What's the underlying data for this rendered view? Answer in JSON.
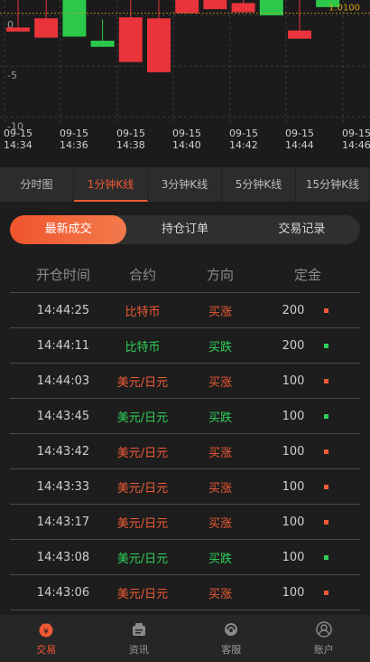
{
  "chart_data": {
    "type": "candlestick",
    "y_ticks": [
      "0",
      "-5",
      "-10"
    ],
    "x_labels": [
      {
        "date": "09-15",
        "time": "14:34"
      },
      {
        "date": "09-15",
        "time": "14:36"
      },
      {
        "date": "09-15",
        "time": "14:38"
      },
      {
        "date": "09-15",
        "time": "14:40"
      },
      {
        "date": "09-15",
        "time": "14:42"
      },
      {
        "date": "09-15",
        "time": "14:44"
      },
      {
        "date": "09-15",
        "time": "14:46"
      }
    ],
    "current_price_label": "1.0100",
    "ylim": [
      -10.5,
      1.5
    ],
    "candles": [
      {
        "open": -1.2,
        "close": -1.6,
        "high": 1.5,
        "low": -1.6
      },
      {
        "open": -0.3,
        "close": -2.2,
        "high": 1.5,
        "low": -2.2
      },
      {
        "open": -2.1,
        "close": 1.5,
        "high": 1.5,
        "low": -2.1
      },
      {
        "open": -3.1,
        "close": -2.5,
        "high": -0.4,
        "low": -3.1
      },
      {
        "open": -0.2,
        "close": -4.6,
        "high": 1.5,
        "low": -4.6
      },
      {
        "open": -0.3,
        "close": -5.6,
        "high": 1.5,
        "low": -5.6
      },
      {
        "open": 1.5,
        "close": 0.2,
        "high": 1.5,
        "low": 0.2
      },
      {
        "open": 1.5,
        "close": 0.6,
        "high": 1.5,
        "low": 0.6
      },
      {
        "open": 1.2,
        "close": 0.3,
        "high": 1.5,
        "low": 0.3
      },
      {
        "open": 0.0,
        "close": 1.5,
        "high": 1.5,
        "low": 0.0
      },
      {
        "open": -1.5,
        "close": -2.3,
        "high": 1.5,
        "low": -2.3
      },
      {
        "open": 0.8,
        "close": 1.5,
        "high": 1.5,
        "low": 0.8
      }
    ],
    "colors": {
      "up": "#e8343a",
      "down": "#2cc84a",
      "grid": "#3a3a3a",
      "price": "#d4a017"
    }
  },
  "period_tabs": [
    "分时图",
    "1分钟K线",
    "3分钟K线",
    "5分钟K线",
    "15分钟K线"
  ],
  "active_period": 1,
  "segments": [
    "最新成交",
    "持仓订单",
    "交易记录"
  ],
  "active_segment": 0,
  "table": {
    "headers": {
      "time": "开仓时间",
      "contract": "合约",
      "direction": "方向",
      "amount": "定金"
    },
    "rows": [
      {
        "time": "14:44:25",
        "contract": "比特币",
        "direction": "买涨",
        "amount": "200",
        "side": "up"
      },
      {
        "time": "14:44:11",
        "contract": "比特币",
        "direction": "买跌",
        "amount": "200",
        "side": "down"
      },
      {
        "time": "14:44:03",
        "contract": "美元/日元",
        "direction": "买涨",
        "amount": "100",
        "side": "up"
      },
      {
        "time": "14:43:45",
        "contract": "美元/日元",
        "direction": "买跌",
        "amount": "100",
        "side": "down"
      },
      {
        "time": "14:43:42",
        "contract": "美元/日元",
        "direction": "买涨",
        "amount": "100",
        "side": "up"
      },
      {
        "time": "14:43:33",
        "contract": "美元/日元",
        "direction": "买涨",
        "amount": "100",
        "side": "up"
      },
      {
        "time": "14:43:17",
        "contract": "美元/日元",
        "direction": "买涨",
        "amount": "100",
        "side": "up"
      },
      {
        "time": "14:43:08",
        "contract": "美元/日元",
        "direction": "买跌",
        "amount": "100",
        "side": "down"
      },
      {
        "time": "14:43:06",
        "contract": "美元/日元",
        "direction": "买涨",
        "amount": "100",
        "side": "up"
      }
    ]
  },
  "bottom_nav": [
    {
      "label": "交易",
      "icon": "trade-icon",
      "active": true
    },
    {
      "label": "资讯",
      "icon": "news-icon",
      "active": false
    },
    {
      "label": "客服",
      "icon": "service-icon",
      "active": false
    },
    {
      "label": "账户",
      "icon": "account-icon",
      "active": false
    }
  ],
  "colors": {
    "accent": "#ef5a35",
    "up": "#ef5a35",
    "down": "#2ed158"
  }
}
